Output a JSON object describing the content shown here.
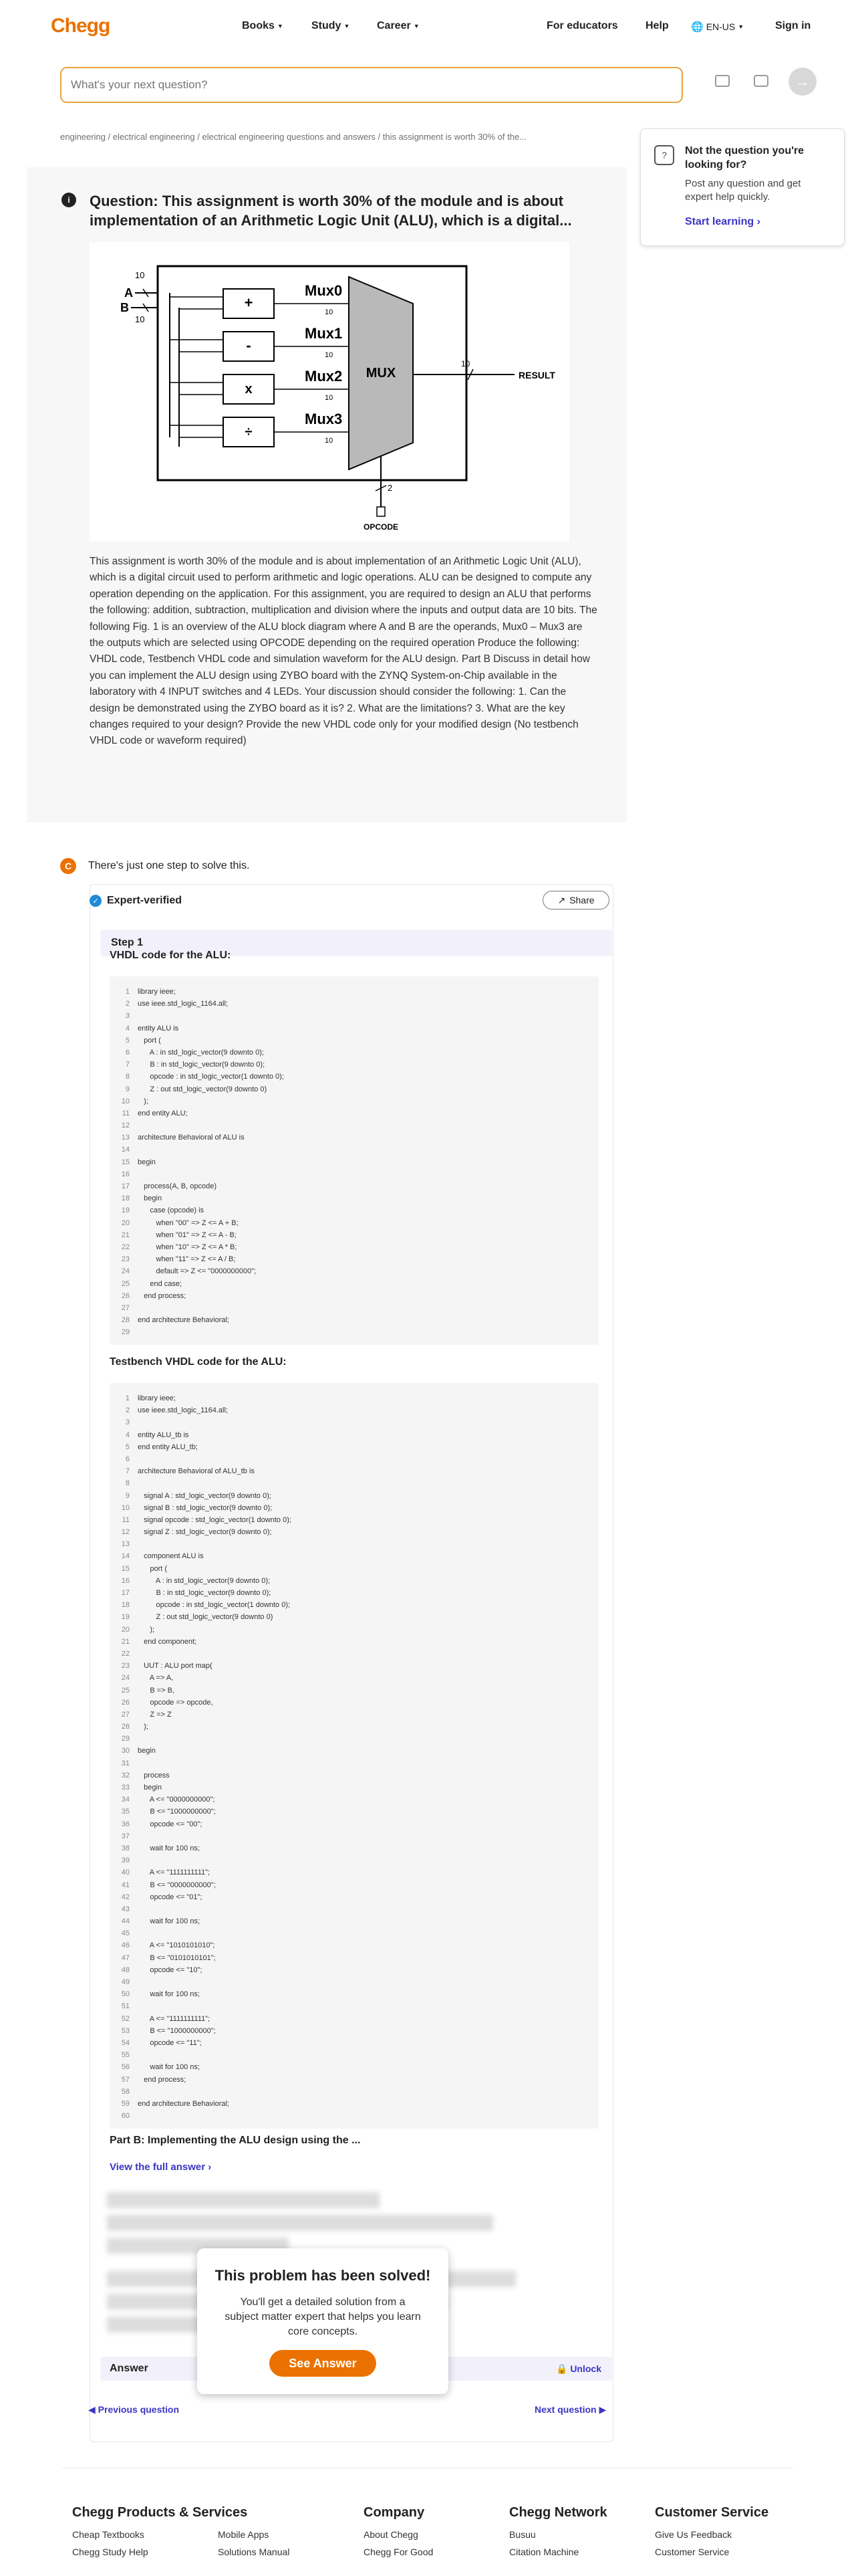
{
  "header": {
    "logo": "Chegg",
    "nav": [
      "Books",
      "Study",
      "Career"
    ],
    "right_links": [
      "For educators",
      "Help"
    ],
    "locale": "EN-US",
    "signin": "Sign in"
  },
  "search": {
    "placeholder": "What's your next question?"
  },
  "breadcrumb": "engineering / electrical engineering / electrical engineering questions and answers / this assignment is worth 30% of the...",
  "sidebar": {
    "title": "Not the question you're looking for?",
    "desc": "Post any question and get expert help quickly.",
    "link": "Start learning"
  },
  "question": {
    "title": "Question: This assignment is worth 30% of the module and is about implementation of an Arithmetic Logic Unit (ALU), which is a digital...",
    "body": "This assignment is worth 30% of the module and is about implementation of an Arithmetic Logic Unit (ALU), which is a digital circuit used to perform arithmetic and logic operations. ALU can be designed to compute any operation depending on the application. For this assignment, you are required to design an ALU that performs the following: addition, subtraction, multiplication and division where the inputs and output data are 10 bits. The following Fig. 1 is an overview of the ALU block diagram where A and B are the operands, Mux0 – Mux3 are the outputs which are selected using OPCODE depending on the required operation Produce the following: VHDL code, Testbench VHDL code and simulation waveform for the ALU design. Part B Discuss in detail how you can implement the ALU design using ZYBO board with the ZYNQ System-on-Chip available in the laboratory with 4 INPUT switches and 4 LEDs. Your discussion should consider the following: 1. Can the design be demonstrated using the ZYBO board as it is? 2. What are the limitations? 3. What are the key changes required to your design? Provide the new VHDL code only for your modified design (No testbench VHDL code or waveform required)",
    "diagram": {
      "ops": [
        "+",
        "-",
        "x",
        "÷"
      ],
      "mux_labels": [
        "Mux0",
        "Mux1",
        "Mux2",
        "Mux3"
      ],
      "mux": "MUX",
      "input_a": "A",
      "input_b": "B",
      "width": "10",
      "sel_width": "2",
      "result": "RESULT",
      "opcode": "OPCODE"
    }
  },
  "solution": {
    "badge": "C",
    "intro": "There's just one step to solve this.",
    "verified": "Expert-verified",
    "share": "Share",
    "step": "Step 1",
    "vhdl_heading": "VHDL code for the ALU:",
    "vhdl_code": [
      "library ieee;",
      "use ieee.std_logic_1164.all;",
      "",
      "entity ALU is",
      "   port (",
      "      A : in std_logic_vector(9 downto 0);",
      "      B : in std_logic_vector(9 downto 0);",
      "      opcode : in std_logic_vector(1 downto 0);",
      "      Z : out std_logic_vector(9 downto 0)",
      "   );",
      "end entity ALU;",
      "",
      "architecture Behavioral of ALU is",
      "",
      "begin",
      "",
      "   process(A, B, opcode)",
      "   begin",
      "      case (opcode) is",
      "         when \"00\" => Z <= A + B;",
      "         when \"01\" => Z <= A - B;",
      "         when \"10\" => Z <= A * B;",
      "         when \"11\" => Z <= A / B;",
      "         default => Z <= \"0000000000\";",
      "      end case;",
      "   end process;",
      "",
      "end architecture Behavioral;",
      ""
    ],
    "tb_heading": "Testbench VHDL code for the ALU:",
    "tb_code": [
      "library ieee;",
      "use ieee.std_logic_1164.all;",
      "",
      "entity ALU_tb is",
      "end entity ALU_tb;",
      "",
      "architecture Behavioral of ALU_tb is",
      "",
      "   signal A : std_logic_vector(9 downto 0);",
      "   signal B : std_logic_vector(9 downto 0);",
      "   signal opcode : std_logic_vector(1 downto 0);",
      "   signal Z : std_logic_vector(9 downto 0);",
      "",
      "   component ALU is",
      "      port (",
      "         A : in std_logic_vector(9 downto 0);",
      "         B : in std_logic_vector(9 downto 0);",
      "         opcode : in std_logic_vector(1 downto 0);",
      "         Z : out std_logic_vector(9 downto 0)",
      "      );",
      "   end component;",
      "",
      "   UUT : ALU port map(",
      "      A => A,",
      "      B => B,",
      "      opcode => opcode,",
      "      Z => Z",
      "   );",
      "",
      "begin",
      "",
      "   process",
      "   begin",
      "      A <= \"0000000000\";",
      "      B <= \"1000000000\";",
      "      opcode <= \"00\";",
      "",
      "      wait for 100 ns;",
      "",
      "      A <= \"1111111111\";",
      "      B <= \"0000000000\";",
      "      opcode <= \"01\";",
      "",
      "      wait for 100 ns;",
      "",
      "      A <= \"1010101010\";",
      "      B <= \"0101010101\";",
      "      opcode <= \"10\";",
      "",
      "      wait for 100 ns;",
      "",
      "      A <= \"1111111111\";",
      "      B <= \"1000000000\";",
      "      opcode <= \"11\";",
      "",
      "      wait for 100 ns;",
      "   end process;",
      "",
      "end architecture Behavioral;",
      ""
    ],
    "partb_heading": "Part B: Implementing the ALU design using the ...",
    "view_full": "View the full answer",
    "answer_label": "Answer",
    "unlock": "Unlock"
  },
  "modal": {
    "title": "This problem has been solved!",
    "text": "You'll get a detailed solution from a subject matter expert that helps you learn core concepts.",
    "button": "See Answer"
  },
  "pager": {
    "prev": "Previous question",
    "next": "Next question"
  },
  "footer": {
    "col1_title": "Chegg Products & Services",
    "col1": [
      "Cheap Textbooks",
      "Chegg Study Help"
    ],
    "col1b": [
      "Mobile Apps",
      "Solutions Manual"
    ],
    "col2_title": "Company",
    "col2": [
      "About Chegg",
      "Chegg For Good"
    ],
    "col3_title": "Chegg Network",
    "col3": [
      "Busuu",
      "Citation Machine"
    ],
    "col4_title": "Customer Service",
    "col4": [
      "Give Us Feedback",
      "Customer Service"
    ]
  },
  "colors": {
    "brand": "#eb7100",
    "link": "#3c35c4"
  }
}
